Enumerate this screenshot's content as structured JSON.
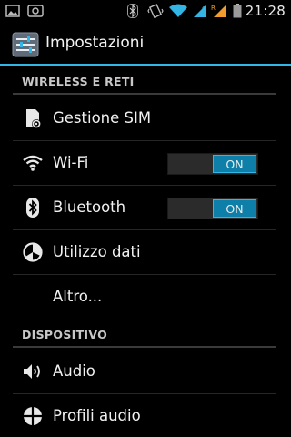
{
  "status_bar": {
    "time": "21:28",
    "icons": [
      "picture-icon",
      "android-screenshot-icon",
      "bluetooth-icon",
      "vibrate-icon",
      "wifi-icon",
      "signal-icon",
      "signal-roaming-icon",
      "battery-icon"
    ]
  },
  "action_bar": {
    "title": "Impostazioni",
    "icon": "settings-app-icon"
  },
  "sections": {
    "wireless": {
      "title": "WIRELESS E RETI"
    },
    "device": {
      "title": "DISPOSITIVO"
    }
  },
  "items": {
    "sim": {
      "label": "Gestione SIM",
      "icon": "sim-icon"
    },
    "wifi": {
      "label": "Wi-Fi",
      "icon": "wifi-icon",
      "toggle": "ON"
    },
    "bluetooth": {
      "label": "Bluetooth",
      "icon": "bluetooth-icon",
      "toggle": "ON"
    },
    "data": {
      "label": "Utilizzo dati",
      "icon": "data-usage-icon"
    },
    "more": {
      "label": "Altro..."
    },
    "audio": {
      "label": "Audio",
      "icon": "speaker-icon"
    },
    "profiles": {
      "label": "Profili audio",
      "icon": "audio-profiles-icon"
    }
  },
  "colors": {
    "accent": "#33b5e5",
    "toggle_on": "#0e7fa8",
    "background": "#000000"
  }
}
